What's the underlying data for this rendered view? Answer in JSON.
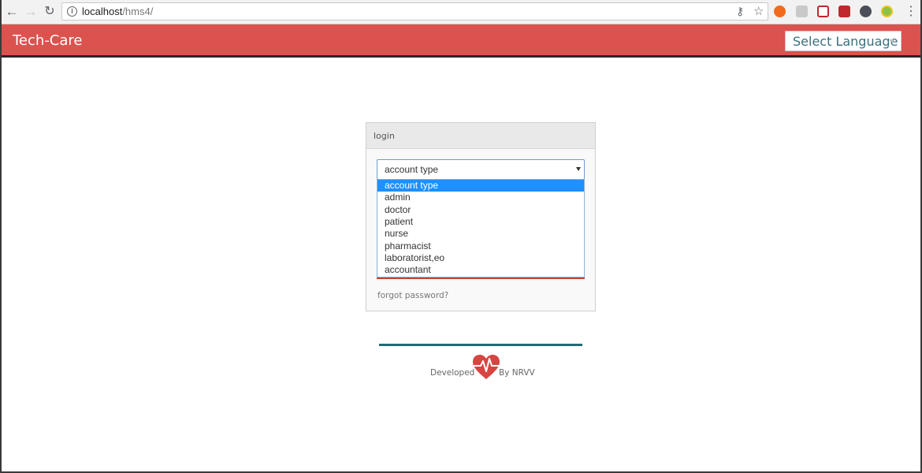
{
  "browser": {
    "url_host": "localhost",
    "url_path": "/hms4/"
  },
  "header": {
    "brand": "Tech-Care",
    "language_select": "Select Language"
  },
  "login": {
    "panel_title": "login",
    "account_select_value": "account type",
    "options": [
      "account type",
      "admin",
      "doctor",
      "patient",
      "nurse",
      "pharmacist",
      "laboratorist,eo",
      "accountant"
    ],
    "forgot_link": "forgot password?"
  },
  "footer": {
    "developed": "Developed",
    "by": "By NRVV"
  },
  "colors": {
    "header_bg": "#dc524e",
    "footer_line": "#1f6a74",
    "selected_option": "#1e90ff"
  },
  "icons": [
    "back-arrow-icon",
    "forward-arrow-icon",
    "reload-icon",
    "info-icon",
    "key-icon",
    "star-icon",
    "heart-pulse-icon",
    "menu-dots-icon"
  ]
}
